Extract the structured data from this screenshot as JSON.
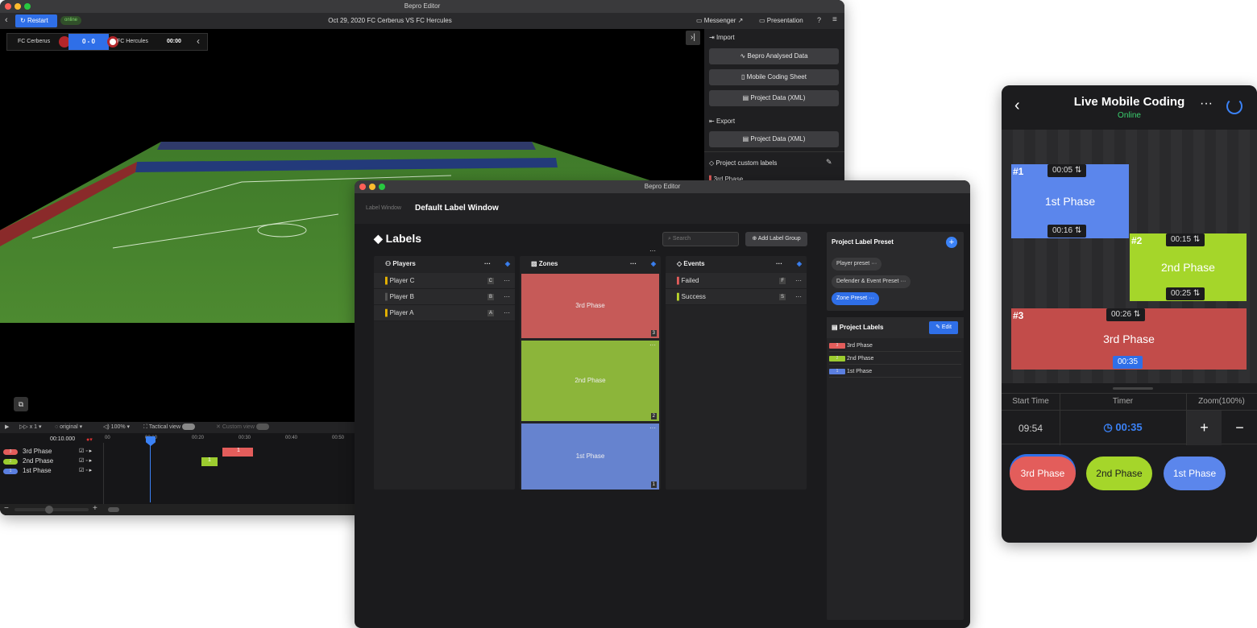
{
  "editor": {
    "title": "Bepro Editor",
    "restart": "Restart",
    "status": "online",
    "match_title": "Oct 29, 2020 FC Cerberus VS FC Hercules",
    "messenger": "Messenger",
    "presentation": "Presentation",
    "home_team": "FC Cerberus",
    "score": "0 - 0",
    "away_team": "FC Hercules",
    "clock": "00:00",
    "import_label": "Import",
    "import_buttons": [
      "Bepro Analysed Data",
      "Mobile Coding Sheet",
      "Project Data (XML)"
    ],
    "export_label": "Export",
    "export_button": "Project Data (XML)",
    "custom_labels": "Project custom labels",
    "custom_first": "3rd Phase",
    "speed": "x 1",
    "quality": "original",
    "volume": "100%",
    "tactical": "Tactical view",
    "custom_view": "Custom view",
    "timecode": "00:10.000",
    "ticks": [
      "00",
      "00:10",
      "00:20",
      "00:30",
      "00:40",
      "00:50"
    ],
    "tracks": [
      {
        "key": "3",
        "name": "3rd Phase",
        "color": "#e35d5b"
      },
      {
        "key": "2",
        "name": "2nd Phase",
        "color": "#9ccc2f"
      },
      {
        "key": "1",
        "name": "1st Phase",
        "color": "#5b7fe0"
      }
    ],
    "clip_3": "1",
    "clip_2": "1"
  },
  "labelwin": {
    "title": "Bepro Editor",
    "crumb": "Label Window",
    "name": "Default Label Window",
    "heading": "Labels",
    "search_placeholder": "Search",
    "add_group": "Add Label Group",
    "players_title": "Players",
    "players": [
      {
        "name": "Player C",
        "key": "C",
        "color": "#e8b400"
      },
      {
        "name": "Player B",
        "key": "B",
        "color": "#555"
      },
      {
        "name": "Player A",
        "key": "A",
        "color": "#e8b400"
      }
    ],
    "zones_title": "Zones",
    "zones": [
      {
        "name": "3rd Phase",
        "key": "3",
        "color": "#c65a58"
      },
      {
        "name": "2nd Phase",
        "key": "2",
        "color": "#8cb53a"
      },
      {
        "name": "1st Phase",
        "key": "1",
        "color": "#6683cf"
      }
    ],
    "events_title": "Events",
    "events": [
      {
        "name": "Failed",
        "key": "F",
        "color": "#e35d5b"
      },
      {
        "name": "Success",
        "key": "S",
        "color": "#b9d42b"
      }
    ],
    "preset_title": "Project Label Preset",
    "presets": [
      "Player preset",
      "Defender & Event Preset",
      "Zone Preset"
    ],
    "plabels_title": "Project Labels",
    "edit": "Edit",
    "plabels": [
      {
        "key": "3",
        "name": "3rd Phase",
        "color": "#e35d5b"
      },
      {
        "key": "2",
        "name": "2nd Phase",
        "color": "#9ccc2f"
      },
      {
        "key": "1",
        "name": "1st Phase",
        "color": "#5b7fe0"
      }
    ]
  },
  "mobile": {
    "title": "Live Mobile Coding",
    "status": "Online",
    "phases": [
      {
        "num": "#1",
        "name": "1st Phase",
        "start": "00:05",
        "end": "00:16",
        "color": "#5b86ec"
      },
      {
        "num": "#2",
        "name": "2nd Phase",
        "start": "00:15",
        "end": "00:25",
        "color": "#a5d62a"
      },
      {
        "num": "#3",
        "name": "3rd Phase",
        "start": "00:26",
        "end": "00:35",
        "color": "#c24c4a"
      }
    ],
    "start_time_label": "Start Time",
    "timer_label": "Timer",
    "zoom_label": "Zoom(100%)",
    "start_time": "09:54",
    "timer": "00:35",
    "buttons": [
      {
        "name": "3rd Phase",
        "color": "#e35d5b"
      },
      {
        "name": "2nd Phase",
        "color": "#a5d62a"
      },
      {
        "name": "1st Phase",
        "color": "#5b86ec"
      }
    ]
  }
}
